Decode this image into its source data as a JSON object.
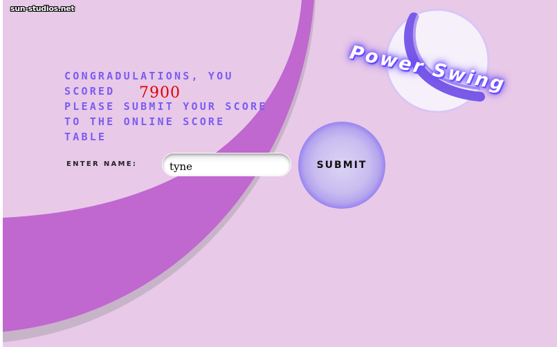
{
  "site": {
    "credit": "sun-studios.net"
  },
  "logo": {
    "text": "Power Swing",
    "icon": "sphere-icon"
  },
  "message": {
    "line1": "CONGRADULATIONS,  YOU",
    "line2": "SCORED",
    "line3": "PLEASE  SUBMIT  YOUR  SCORE",
    "line4": "TO  THE  ONLINE  SCORE",
    "line5": "TABLE"
  },
  "score": {
    "value": "7900"
  },
  "form": {
    "name_label": "ENTER  NAME:",
    "name_value": "tyne",
    "submit_label": "SUBMIT"
  },
  "colors": {
    "background": "#e8c9e8",
    "arc": "#c067d0",
    "text": "#7a5cf0",
    "score": "#e00000"
  }
}
